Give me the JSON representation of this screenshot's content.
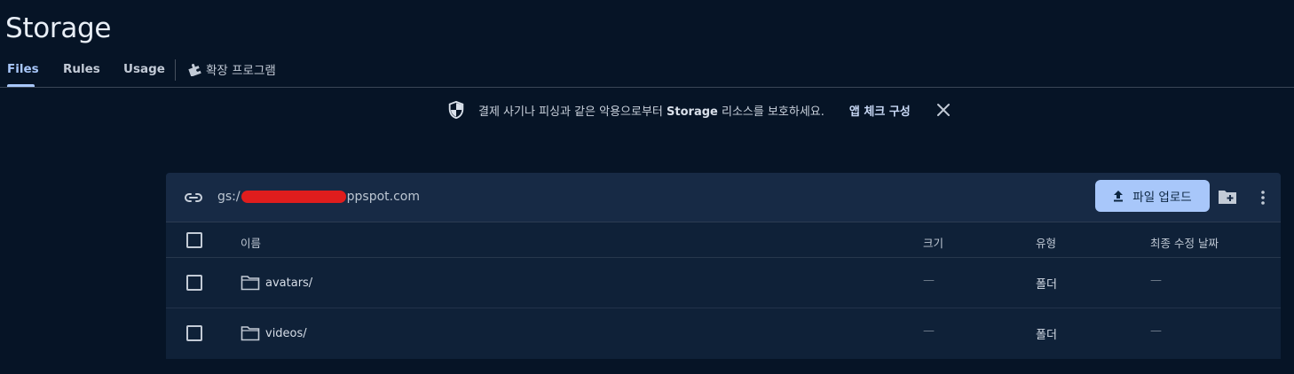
{
  "page": {
    "title": "Storage"
  },
  "tabs": [
    {
      "label": "Files",
      "active": true
    },
    {
      "label": "Rules"
    },
    {
      "label": "Usage"
    }
  ],
  "extensions_tab": {
    "label": "확장 프로그램",
    "icon": "puzzle-icon"
  },
  "banner": {
    "message_pre": "결제 사기나 피싱과 같은 악용으로부터 ",
    "message_bold": "Storage",
    "message_post": " 리소스를 보호하세요.",
    "action": "앱 체크 구성",
    "icon": "shield-icon"
  },
  "bucket": {
    "prefix": "gs:/",
    "suffix": "ppspot.com",
    "upload_label": "파일 업로드"
  },
  "table": {
    "columns": {
      "name": "이름",
      "size": "크기",
      "type": "유형",
      "modified": "최종 수정 날짜"
    },
    "rows": [
      {
        "name": "avatars/",
        "size": "—",
        "type": "폴더",
        "modified": "—"
      },
      {
        "name": "videos/",
        "size": "—",
        "type": "폴더",
        "modified": "—"
      }
    ]
  },
  "colors": {
    "accent": "#a8c7fa",
    "background": "#061426",
    "card": "#0f2138"
  }
}
